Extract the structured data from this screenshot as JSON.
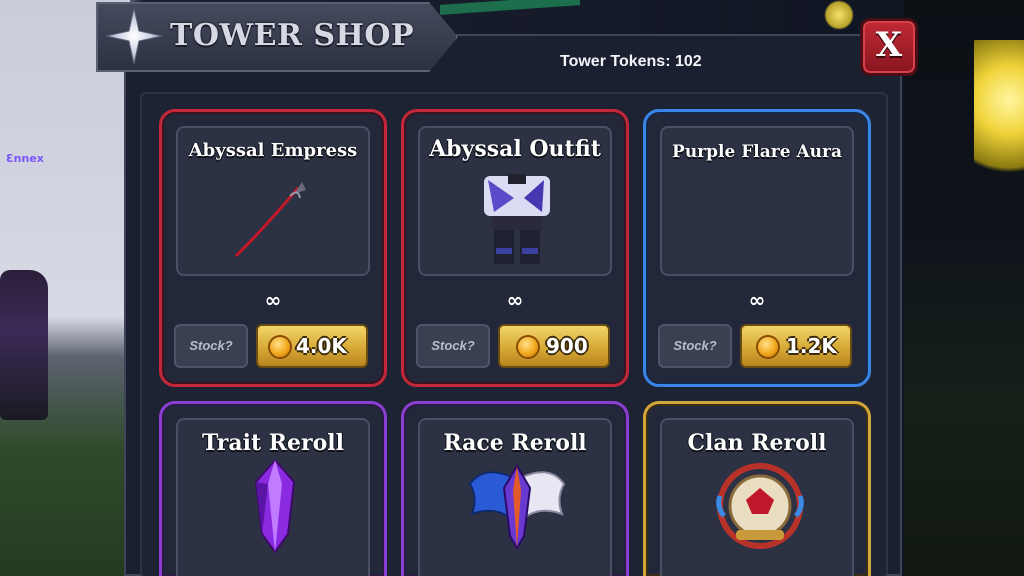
{
  "background": {
    "player_tag": "Ɛnnex"
  },
  "header": {
    "title": "TOWER SHOP",
    "tokens_label": "Tower Tokens: 102",
    "close_label": "X"
  },
  "colors": {
    "panel": "#1b2030",
    "close": "#c22a34",
    "price_gold": "#d6a937",
    "rarity_red": "#c2283a",
    "rarity_blue": "#3a86e6",
    "rarity_purple": "#8a3fd0",
    "rarity_gold": "#d3a63a"
  },
  "items": [
    {
      "name": "Abyssal Empress",
      "stock": "∞",
      "stock_button": "Stock?",
      "price": "4.0K",
      "rarity_color": "red",
      "icon": "scythe-icon"
    },
    {
      "name": "Abyssal Outfit",
      "stock": "∞",
      "stock_button": "Stock?",
      "price": "900",
      "rarity_color": "red",
      "icon": "outfit-icon"
    },
    {
      "name": "Purple Flare Aura",
      "stock": "∞",
      "stock_button": "Stock?",
      "price": "1.2K",
      "rarity_color": "blue",
      "icon": ""
    },
    {
      "name": "Trait Reroll",
      "rarity_color": "purple",
      "icon": "crystal-icon"
    },
    {
      "name": "Race Reroll",
      "rarity_color": "purple",
      "icon": "wing-crystal-icon"
    },
    {
      "name": "Clan Reroll",
      "rarity_color": "gold",
      "icon": "scroll-icon"
    }
  ]
}
